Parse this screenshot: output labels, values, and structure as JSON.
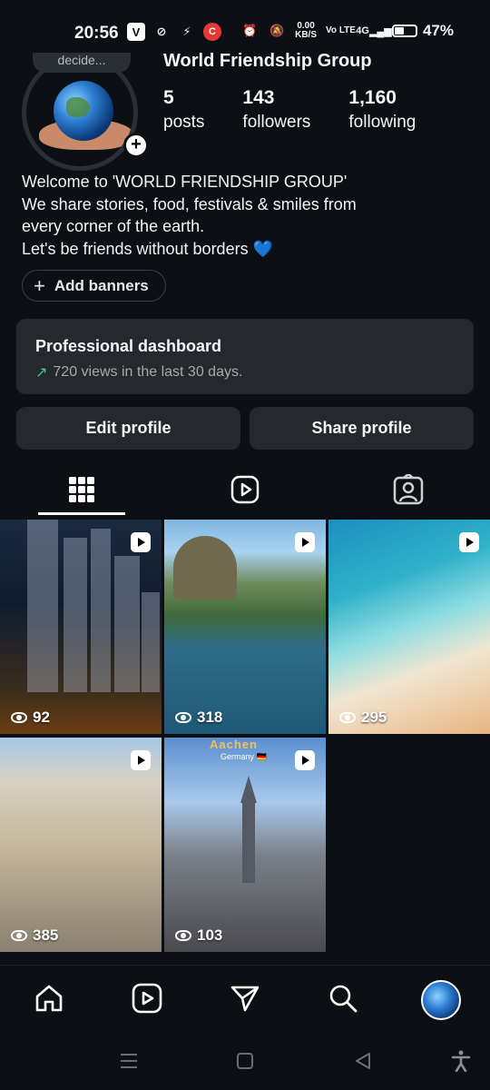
{
  "status_bar": {
    "time": "20:56",
    "net_speed_top": "0.00",
    "net_speed_bottom": "KB/S",
    "volte": "Vo LTE",
    "network": "4G",
    "battery": "47%"
  },
  "profile": {
    "note": "decide...",
    "name": "World Friendship Group",
    "stats": [
      {
        "value": "5",
        "label": "posts"
      },
      {
        "value": "143",
        "label": "followers"
      },
      {
        "value": "1,160",
        "label": "following"
      }
    ],
    "bio_lines": [
      "Welcome to 'WORLD FRIENDSHIP GROUP'",
      "We share stories, food, festivals & smiles from",
      "every corner of the earth.",
      "Let's be friends without borders 💙"
    ],
    "add_banners_label": "Add banners"
  },
  "dashboard": {
    "title": "Professional dashboard",
    "subtitle": "720 views in the last 30 days."
  },
  "actions": {
    "edit_label": "Edit profile",
    "share_label": "Share profile"
  },
  "tabs": [
    {
      "icon": "grid-icon",
      "active": true
    },
    {
      "icon": "reels-icon",
      "active": false
    },
    {
      "icon": "tagged-icon",
      "active": false
    }
  ],
  "posts": [
    {
      "views": "92",
      "type": "reel",
      "scene": "city-night"
    },
    {
      "views": "318",
      "type": "reel",
      "scene": "harbor-mountain"
    },
    {
      "views": "295",
      "type": "reel",
      "scene": "beach"
    },
    {
      "views": "385",
      "type": "reel",
      "scene": "promenade"
    },
    {
      "views": "103",
      "type": "reel",
      "scene": "aachen-street",
      "overlay_title": "Aachen",
      "overlay_sub": "Germany 🇩🇪"
    }
  ],
  "bottom_nav": [
    "home-icon",
    "reels-icon",
    "send-icon",
    "search-icon",
    "profile-avatar"
  ],
  "colors": {
    "background": "#0c1014",
    "card": "#25292e",
    "trend_green": "#3ad36b"
  }
}
